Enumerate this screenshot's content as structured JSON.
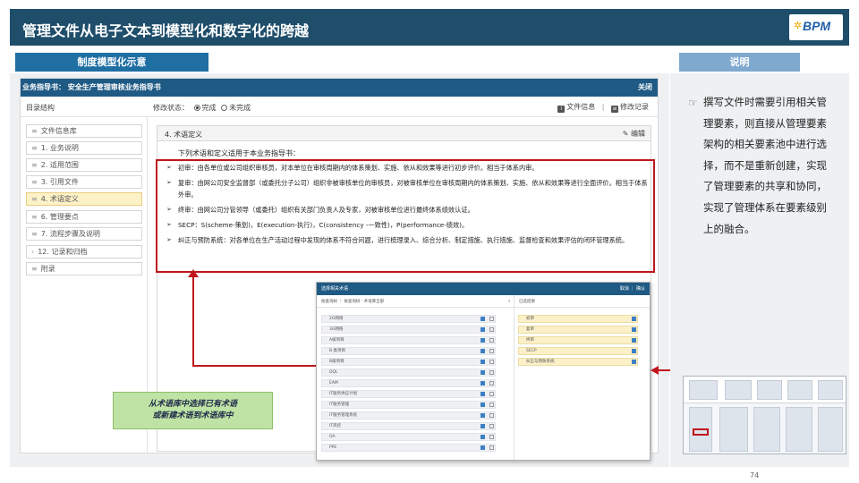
{
  "slide": {
    "title": "管理文件从电子文本到模型化和数字化的跨越",
    "logo_text": "BPM",
    "page_number": "74"
  },
  "headers": {
    "left": "制度模型化示意",
    "right": "说明"
  },
  "app": {
    "title": "业务指导书：  安全生产管理审核业务指导书",
    "close_label": "关闭",
    "toc_title": "目录结构",
    "status_label": "修改状态：",
    "status_options": [
      "完成",
      "未完成"
    ],
    "link_file_info": "文件信息",
    "link_change_log": "修改记录",
    "toc_items": [
      {
        "label": "文件信息库",
        "mark": "≡"
      },
      {
        "label": "1. 业务说明",
        "mark": "≡"
      },
      {
        "label": "2. 适用范围",
        "mark": "≡"
      },
      {
        "label": "3. 引用文件",
        "mark": "≡"
      },
      {
        "label": "4. 术语定义",
        "mark": "≡"
      },
      {
        "label": "6. 管理要点",
        "mark": "≡"
      },
      {
        "label": "7. 流程步骤及说明",
        "mark": "≡"
      },
      {
        "label": "12. 记录和归档",
        "mark": "›"
      },
      {
        "label": "附录",
        "mark": "≡"
      }
    ],
    "section_title": "4. 术语定义",
    "edit_label": "编辑",
    "intro": "下列术语和定义适用于本业务指导书：",
    "terms": [
      "初审：由各单位或公司组织审核员，对本单位在审核周期内的体系策划、实施、依从和效果等进行初步评价。相当于体系内审。",
      "复审：由网公司安全监督部（或委托分子公司）组织非被审核单位的审核员，对被审核单位在审核周期内的体系策划、实施、依从和效果等进行全面评价。相当于体系外审。",
      "终审：由网公司分管领导（或委托）组织有关部门负责人及专家，对被审核单位进行最终体系绩效认证。",
      "SECP：S(scheme-策划)，E(execution-执行)，C(consistency -一致性)，P(performance-绩效)。",
      "纠正与预防系统：对各单位在生产活动过程中发现的体系不符合问题，进行梳理录入、综合分析、制定措施、执行措施、监督检查和效果评估的闭环管理系统。"
    ]
  },
  "popup": {
    "title": "选择相关术语",
    "buttons": "取消 ｜ 确认",
    "search_left": "按查询树 ｜ 按查询树 · 术语库全部",
    "search_right": "已选结果",
    "left_items": [
      "2G网络",
      "3G网络",
      "A级项目",
      "B 类项目",
      "B级项目",
      "DQL",
      "EAM",
      "IT服务供应计划",
      "IT服务管理",
      "IT服务管理系统",
      "IT风控",
      "OA",
      "PPE"
    ],
    "right_items": [
      "初审",
      "复审",
      "终审",
      "SECP",
      "纠正与预防系统"
    ]
  },
  "callout": {
    "line1": "从术语库中选择已有术语",
    "line2": "或新建术语到术语库中"
  },
  "note": {
    "text": "撰写文件时需要引用相关管理要素，则直接从管理要素架构的相关要素池中进行选择，而不是重新创建，实现了管理要素的共享和协同，实现了管理体系在要素级别上的融合。"
  },
  "colors": {
    "title_bar": "#1f4e6b",
    "header_left": "#1f6fa3",
    "header_right": "#7fa9cf",
    "highlight_red": "#c0161c",
    "callout_green": "#bfe3a4"
  }
}
